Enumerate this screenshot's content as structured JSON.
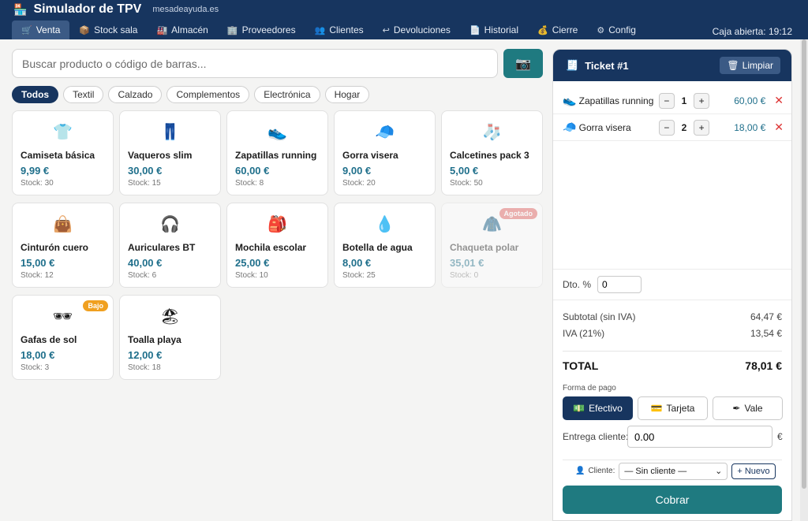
{
  "app": {
    "title": "Simulador de TPV",
    "site": "mesadeayuda.es",
    "status": "Caja abierta: 19:12"
  },
  "nav": {
    "tabs": [
      {
        "label": "Venta",
        "icon": "🛒"
      },
      {
        "label": "Stock sala",
        "icon": "📦"
      },
      {
        "label": "Almacén",
        "icon": "🏭"
      },
      {
        "label": "Proveedores",
        "icon": "🏢"
      },
      {
        "label": "Clientes",
        "icon": "👥"
      },
      {
        "label": "Devoluciones",
        "icon": "↩"
      },
      {
        "label": "Historial",
        "icon": "📄"
      },
      {
        "label": "Cierre",
        "icon": "💰"
      },
      {
        "label": "Config",
        "icon": "⚙"
      }
    ]
  },
  "search": {
    "placeholder": "Buscar producto o código de barras...",
    "scan_icon": "camera-icon"
  },
  "filters": [
    "Todos",
    "Textil",
    "Calzado",
    "Complementos",
    "Electrónica",
    "Hogar"
  ],
  "products": [
    {
      "name": "Camiseta básica",
      "price": "9,99 €",
      "stock": "Stock: 30",
      "icon": "👕"
    },
    {
      "name": "Vaqueros slim",
      "price": "30,00 €",
      "stock": "Stock: 15",
      "icon": "👖"
    },
    {
      "name": "Zapatillas running",
      "price": "60,00 €",
      "stock": "Stock: 8",
      "icon": "👟"
    },
    {
      "name": "Gorra visera",
      "price": "9,00 €",
      "stock": "Stock: 20",
      "icon": "🧢"
    },
    {
      "name": "Calcetines pack 3",
      "price": "5,00 €",
      "stock": "Stock: 50",
      "icon": "🧦"
    },
    {
      "name": "Cinturón cuero",
      "price": "15,00 €",
      "stock": "Stock: 12",
      "icon": "👜"
    },
    {
      "name": "Auriculares BT",
      "price": "40,00 €",
      "stock": "Stock: 6",
      "icon": "🎧"
    },
    {
      "name": "Mochila escolar",
      "price": "25,00 €",
      "stock": "Stock: 10",
      "icon": "🎒"
    },
    {
      "name": "Botella de agua",
      "price": "8,00 €",
      "stock": "Stock: 25",
      "icon": "💧"
    },
    {
      "name": "Chaqueta polar",
      "price": "35,01 €",
      "stock": "Stock: 0",
      "icon": "🧥",
      "badge": "Agotado"
    },
    {
      "name": "Gafas de sol",
      "price": "18,00 €",
      "stock": "Stock: 3",
      "icon": "🕶",
      "badge": "Bajo"
    },
    {
      "name": "Toalla playa",
      "price": "12,00 €",
      "stock": "Stock: 18",
      "icon": "🏖"
    }
  ],
  "ticket": {
    "title": "Ticket #1",
    "clear_label": "Limpiar",
    "lines": [
      {
        "name": "Zapatillas running",
        "qty": "1",
        "price": "60,00 €",
        "icon": "👟"
      },
      {
        "name": "Gorra visera",
        "qty": "2",
        "price": "18,00 €",
        "icon": "🧢"
      }
    ],
    "discount_label": "Dto. %",
    "discount_value": "0",
    "subtotal_label": "Subtotal (sin IVA)",
    "subtotal_value": "64,47 €",
    "iva_label": "IVA (21%)",
    "iva_value": "13,54 €",
    "total_label": "TOTAL",
    "total_value": "78,01 €",
    "payment_label": "Forma de pago",
    "payment_methods": [
      "Efectivo",
      "Tarjeta",
      "Vale"
    ],
    "delivery_label": "Entrega cliente:",
    "delivery_value": "0.00",
    "currency": "€",
    "client_label": "Cliente:",
    "client_selected": "— Sin cliente —",
    "new_client_label": "+ Nuevo",
    "charge_label": "Cobrar"
  }
}
